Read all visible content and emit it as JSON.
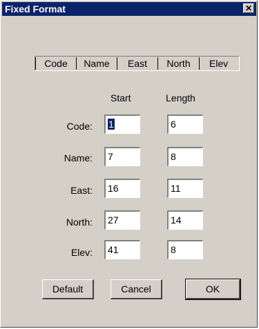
{
  "window": {
    "title": "Fixed Format",
    "close_label": "✕"
  },
  "fields": [
    "Code",
    "Name",
    "East",
    "North",
    "Elev"
  ],
  "columns": {
    "start": "Start",
    "length": "Length"
  },
  "rows": [
    {
      "label": "Code:",
      "start": "1",
      "length": "6"
    },
    {
      "label": "Name:",
      "start": "7",
      "length": "8"
    },
    {
      "label": "East:",
      "start": "16",
      "length": "11"
    },
    {
      "label": "North:",
      "start": "27",
      "length": "14"
    },
    {
      "label": "Elev:",
      "start": "41",
      "length": "8"
    }
  ],
  "buttons": {
    "default": "Default",
    "cancel": "Cancel",
    "ok": "OK"
  },
  "colors": {
    "titlebar": "#0a246a",
    "face": "#d4d0c8",
    "selection": "#0a246a"
  }
}
